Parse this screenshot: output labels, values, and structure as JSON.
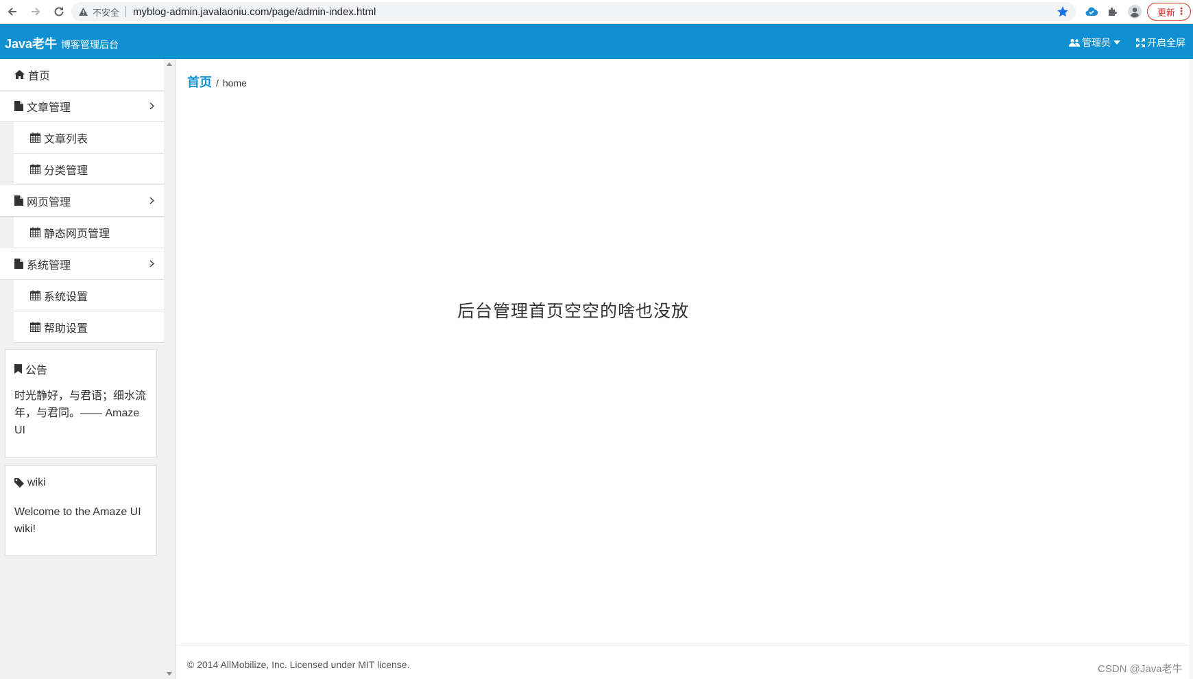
{
  "browser": {
    "security_label": "不安全",
    "url": "myblog-admin.javalaoniu.com/page/admin-index.html",
    "update_label": "更新",
    "menu_glyph": "⋮"
  },
  "header": {
    "brand": "Java老牛",
    "subtitle": "博客管理后台",
    "admin_label": "管理员",
    "fullscreen_label": "开启全屏",
    "color": "#0e90d2"
  },
  "sidebar": {
    "items": [
      {
        "label": "首页",
        "icon": "home-icon"
      },
      {
        "label": "文章管理",
        "icon": "file-icon"
      },
      {
        "label": "文章列表",
        "icon": "calendar-icon"
      },
      {
        "label": "分类管理",
        "icon": "calendar-icon"
      },
      {
        "label": "网页管理",
        "icon": "file-icon"
      },
      {
        "label": "静态网页管理",
        "icon": "calendar-icon"
      },
      {
        "label": "系统管理",
        "icon": "file-icon"
      },
      {
        "label": "系统设置",
        "icon": "calendar-icon"
      },
      {
        "label": "帮助设置",
        "icon": "calendar-icon"
      }
    ]
  },
  "notice": {
    "title": "公告",
    "icon": "bookmark-icon",
    "text": "时光静好，与君语；细水流年，与君同。—— Amaze UI"
  },
  "wiki": {
    "title": "wiki",
    "icon": "tag-icon",
    "text": "Welcome to the Amaze UI wiki!"
  },
  "main": {
    "breadcrumb_home": "首页",
    "breadcrumb_sep": "/",
    "breadcrumb_current": "home",
    "message": "后台管理首页空空的啥也没放"
  },
  "footer": {
    "text": "© 2014 AllMobilize, Inc. Licensed under MIT license."
  },
  "watermark": "CSDN @Java老牛"
}
